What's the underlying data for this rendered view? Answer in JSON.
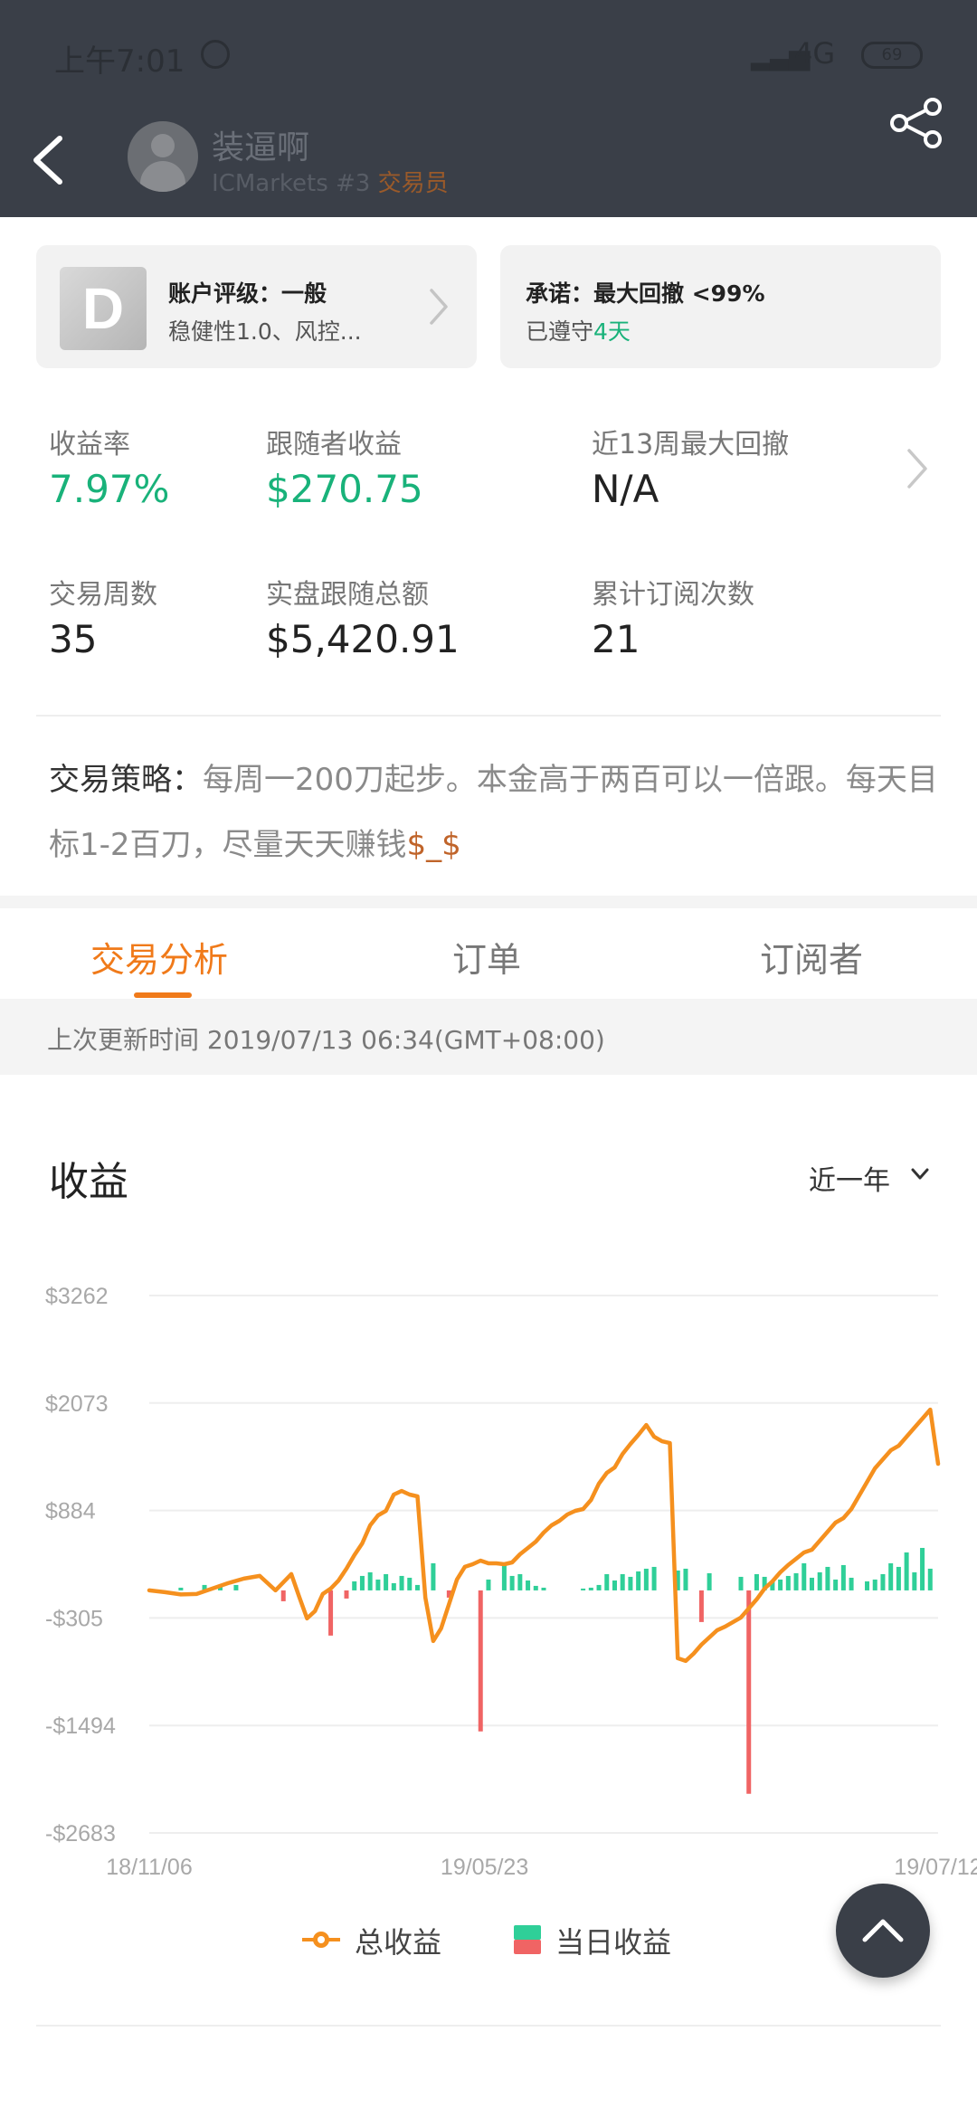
{
  "status_bar": {
    "time": "上午7:01",
    "network": "4G",
    "battery": "69"
  },
  "header": {
    "trader_name": "装逼啊",
    "broker": "ICMarkets #3",
    "role": "交易员"
  },
  "rating_card": {
    "grade": "D",
    "title": "账户评级：一般",
    "subtitle": "稳健性1.0、风控..."
  },
  "promise_card": {
    "title": "承诺：最大回撤 <99%",
    "kept_prefix": "已遵守",
    "kept_days": "4天"
  },
  "stats": {
    "return_rate": {
      "label": "收益率",
      "value": "7.97%"
    },
    "follower_profit": {
      "label": "跟随者收益",
      "value": "$270.75"
    },
    "max_drawdown": {
      "label": "近13周最大回撤",
      "value": "N/A"
    },
    "trade_weeks": {
      "label": "交易周数",
      "value": "35"
    },
    "follow_total": {
      "label": "实盘跟随总额",
      "value": "$5,420.91"
    },
    "subscriptions": {
      "label": "累计订阅次数",
      "value": "21"
    }
  },
  "strategy": {
    "label": "交易策略：",
    "text": "每周一200刀起步。本金高于两百可以一倍跟。每天目标1-2百刀，尽量天天赚钱",
    "suffix": "$_$"
  },
  "tabs": [
    "交易分析",
    "订单",
    "订阅者"
  ],
  "update_text": "上次更新时间 2019/07/13 06:34(GMT+08:00)",
  "chart_section": {
    "title": "收益",
    "range": "近一年"
  },
  "colors": {
    "total_line": "#f5901e",
    "daily_positive": "#2fcf98",
    "daily_negative": "#f06464",
    "accent": "#f07a1a",
    "green_text": "#19b27a"
  },
  "chart_data": {
    "type": "line",
    "title": "收益",
    "ylim": [
      -2683,
      3262
    ],
    "y_ticks": [
      "$3262",
      "$2073",
      "$884",
      "-$305",
      "-$1494",
      "-$2683"
    ],
    "y_tick_values": [
      3262,
      2073,
      884,
      -305,
      -1494,
      -2683
    ],
    "x_tick_labels": [
      "18/11/06",
      "19/05/23",
      "19/07/12"
    ],
    "x_tick_positions": [
      0,
      42.5,
      100
    ],
    "legend": [
      "总收益",
      "当日收益"
    ],
    "series": [
      {
        "name": "总收益",
        "type": "line",
        "x": [
          0,
          2,
          4,
          6,
          8,
          10,
          12,
          14,
          16,
          18,
          19,
          20,
          21,
          22,
          23,
          24,
          25,
          26,
          27,
          28,
          29,
          30,
          31,
          32,
          33,
          34,
          35,
          36,
          37,
          38,
          39,
          40,
          41,
          42,
          43,
          44,
          45,
          46,
          47,
          48,
          49,
          50,
          51,
          52,
          53,
          54,
          55,
          56,
          57,
          58,
          59,
          60,
          61,
          62,
          63,
          64,
          65,
          66,
          67,
          68,
          69,
          70,
          71,
          72,
          73,
          74,
          75,
          76,
          77,
          78,
          79,
          80,
          81,
          82,
          83,
          84,
          85,
          86,
          87,
          88,
          89,
          90,
          91,
          92,
          93,
          94,
          95,
          96,
          97,
          98,
          99,
          100
        ],
        "values": [
          0,
          -20,
          -45,
          -40,
          20,
          80,
          130,
          160,
          0,
          180,
          -70,
          -310,
          -230,
          -40,
          20,
          110,
          240,
          390,
          520,
          720,
          830,
          880,
          1060,
          1100,
          1060,
          1040,
          -80,
          -560,
          -420,
          -150,
          120,
          260,
          290,
          330,
          300,
          300,
          290,
          310,
          400,
          470,
          540,
          640,
          720,
          770,
          840,
          880,
          900,
          1000,
          1180,
          1300,
          1360,
          1510,
          1620,
          1720,
          1830,
          1700,
          1650,
          1630,
          -750,
          -780,
          -700,
          -600,
          -520,
          -440,
          -400,
          -350,
          -300,
          -200,
          -100,
          20,
          100,
          200,
          280,
          350,
          420,
          450,
          550,
          650,
          750,
          800,
          900,
          1050,
          1200,
          1350,
          1450,
          1550,
          1600,
          1700,
          1800,
          1900,
          2000,
          1400
        ]
      },
      {
        "name": "当日收益",
        "type": "bar",
        "x": [
          4,
          7,
          9,
          11,
          17,
          23,
          25,
          26,
          27,
          28,
          29,
          30,
          31,
          32,
          33,
          34,
          36,
          38,
          42,
          43,
          45,
          46,
          47,
          48,
          49,
          50,
          55,
          56,
          57,
          58,
          59,
          60,
          61,
          62,
          63,
          64,
          67,
          68,
          70,
          71,
          75,
          76,
          77,
          78,
          79,
          80,
          81,
          82,
          83,
          84,
          85,
          86,
          87,
          88,
          89,
          91,
          92,
          93,
          94,
          95,
          96,
          97,
          98,
          99
        ],
        "values": [
          30,
          60,
          40,
          60,
          -120,
          -500,
          -90,
          100,
          160,
          200,
          120,
          180,
          80,
          160,
          140,
          60,
          300,
          -80,
          -1560,
          120,
          300,
          160,
          180,
          110,
          50,
          30,
          20,
          30,
          60,
          180,
          110,
          180,
          150,
          210,
          240,
          260,
          220,
          240,
          -350,
          190,
          150,
          -2250,
          180,
          150,
          100,
          120,
          160,
          190,
          300,
          140,
          200,
          260,
          120,
          280,
          140,
          100,
          120,
          180,
          300,
          260,
          420,
          200,
          470,
          240
        ]
      }
    ]
  }
}
